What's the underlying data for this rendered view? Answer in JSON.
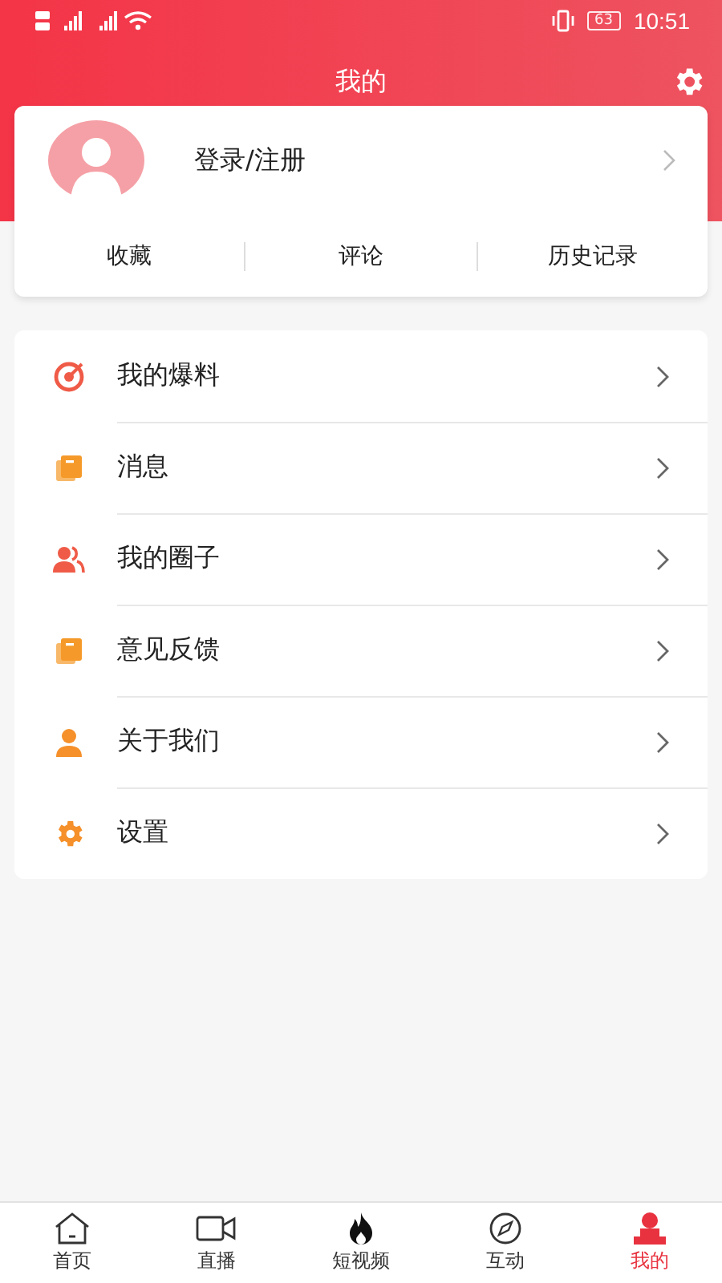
{
  "status_bar": {
    "battery": "63",
    "time": "10:51"
  },
  "header": {
    "title": "我的"
  },
  "profile": {
    "login": "登录/注册",
    "links": [
      "收藏",
      "评论",
      "历史记录"
    ]
  },
  "menu": [
    {
      "label": "我的爆料",
      "kind": "target",
      "color": "#ef5b47"
    },
    {
      "label": "消息",
      "kind": "book",
      "color": "#f59a2a"
    },
    {
      "label": "我的圈子",
      "kind": "people",
      "color": "#ef5b47"
    },
    {
      "label": "意见反馈",
      "kind": "book",
      "color": "#f59a2a"
    },
    {
      "label": "关于我们",
      "kind": "person",
      "color": "#f5902a"
    },
    {
      "label": "设置",
      "kind": "gear",
      "color": "#f5902a"
    }
  ],
  "tabs": [
    {
      "label": "首页",
      "kind": "home",
      "selected": false
    },
    {
      "label": "直播",
      "kind": "camera",
      "selected": false
    },
    {
      "label": "短视频",
      "kind": "flame",
      "selected": false
    },
    {
      "label": "互动",
      "kind": "compass",
      "selected": false
    },
    {
      "label": "我的",
      "kind": "person",
      "selected": true
    }
  ]
}
